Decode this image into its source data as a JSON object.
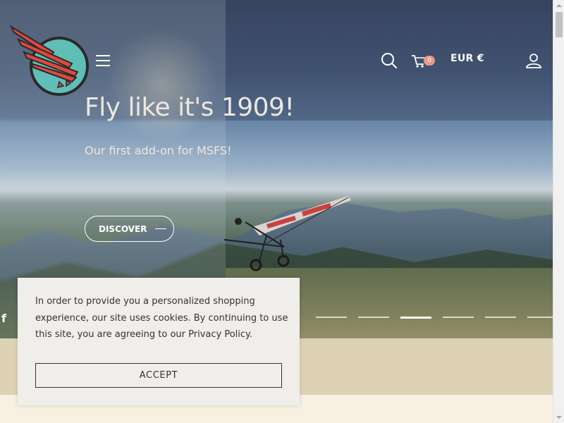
{
  "header": {
    "logo_icon": "winged-logo-icon",
    "menu_icon": "hamburger-menu-icon",
    "search_icon": "search-icon",
    "cart_icon": "cart-icon",
    "cart_count": "0",
    "currency": "EUR  €",
    "account_icon": "user-icon"
  },
  "hero": {
    "title": "Fly like it's 1909!",
    "subtitle": "Our first add-on for MSFS!",
    "cta_label": "DISCOVER",
    "social_icon": "facebook-icon",
    "social_label": "f",
    "slide_count": 6,
    "active_slide": 3
  },
  "cookie_banner": {
    "text": "In order to provide you a personalized shopping experience, our site uses cookies. By continuing to use this site, you are agreeing to our Privacy Policy.",
    "accept_label": "ACCEPT"
  },
  "colors": {
    "accent_salmon": "#e79a85",
    "logo_teal": "#5fbfb6",
    "logo_red": "#e0483f",
    "band_tan": "#ddd3b4",
    "cream": "#f8f1e2"
  }
}
